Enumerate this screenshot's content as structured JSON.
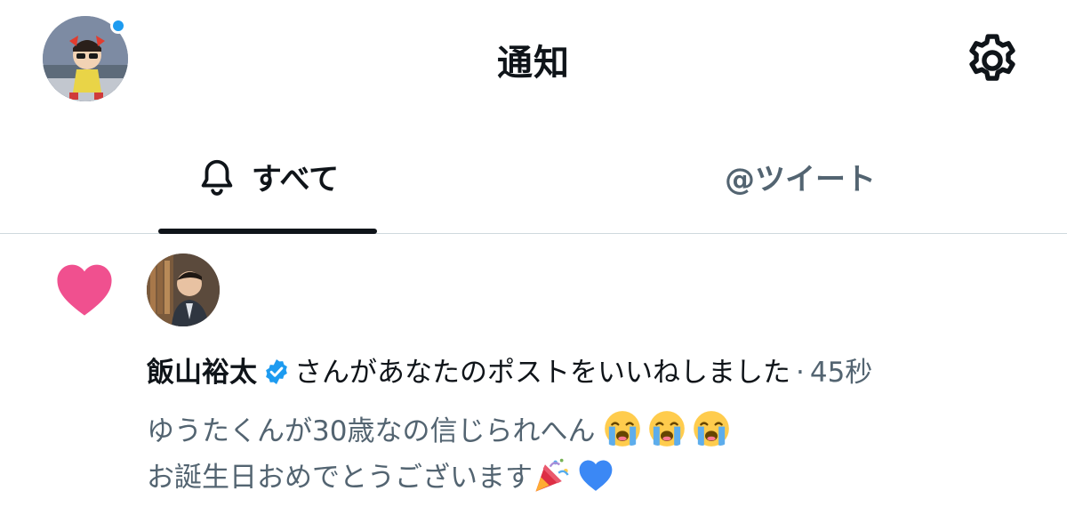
{
  "header": {
    "title": "通知",
    "avatar_icon": "profile-avatar",
    "settings_icon": "gear-icon",
    "unread_dot_color": "#1d9bf0"
  },
  "tabs": [
    {
      "label": "すべて",
      "icon": "bell-icon",
      "active": true
    },
    {
      "label": "@ツイート",
      "active": false
    }
  ],
  "notification": {
    "type": "like",
    "icon": "heart-icon",
    "icon_color": "#f0508f",
    "user_name": "飯山裕太",
    "verified": true,
    "action_text": "さんがあなたのポストをいいねしました",
    "separator": "·",
    "time": "45秒",
    "post_lines": [
      "ゆうたくんが30歳なの信じられへん",
      "お誕生日おめでとうございます"
    ],
    "line1_emojis": [
      "loudly-crying-face",
      "loudly-crying-face",
      "loudly-crying-face"
    ],
    "line2_emojis": [
      "party-popper",
      "blue-heart"
    ]
  },
  "colors": {
    "text_primary": "#0f1419",
    "text_secondary": "#536471",
    "divider": "#cfd9de",
    "accent": "#1d9bf0"
  }
}
